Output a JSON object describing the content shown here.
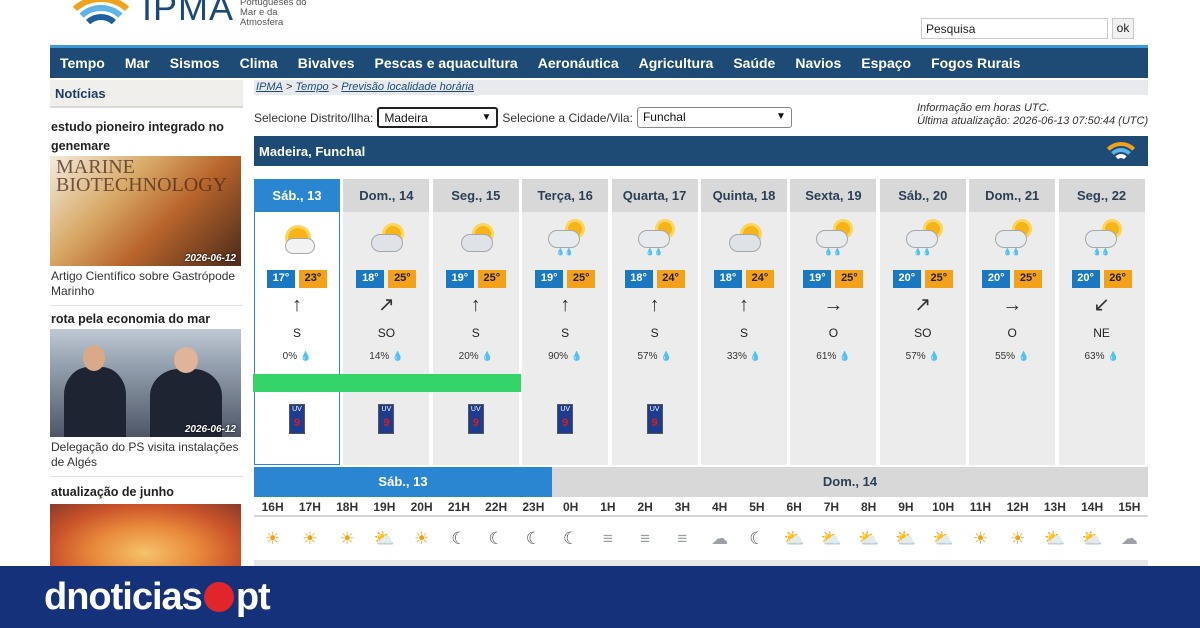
{
  "header": {
    "logo_name": "IPMA",
    "logo_subtitle": "Portuguêses do Mar e da Atmosfera",
    "search_value": "Pesquisa",
    "search_button": "ok"
  },
  "nav": [
    "Tempo",
    "Mar",
    "Sismos",
    "Clima",
    "Bivalves",
    "Pescas e aquacultura",
    "Aeronáutica",
    "Agricultura",
    "Saúde",
    "Navios",
    "Espaço",
    "Fogos Rurais"
  ],
  "sidebar": {
    "heading": "Notícias",
    "news": [
      {
        "title": "estudo pioneiro integrado no genemare",
        "image_text": "MARINE BIOTECHNOLOGY",
        "date": "2026-06-12",
        "caption": "Artigo Científico sobre Gastrópode Marinho"
      },
      {
        "title": "rota pela economia do mar",
        "date": "2026-06-12",
        "caption": "Delegação do PS visita instalações de Algés"
      },
      {
        "title": "atualização de junho"
      }
    ]
  },
  "breadcrumb": {
    "items": [
      "IPMA",
      "Tempo",
      "Previsão localidade horária"
    ],
    "sep": " > "
  },
  "selectors": {
    "district_label": "Selecione Distrito/Ilha:",
    "district_value": "Madeira",
    "city_label": "Selecione a Cidade/Vila:",
    "city_value": "Funchal"
  },
  "info": {
    "line1": "Informação em horas UTC.",
    "line2": "Última atualização: 2026-06-13 07:50:44 (UTC)"
  },
  "location_title": "Madeira, Funchal",
  "days": [
    {
      "label": "Sáb., 13",
      "min": "17°",
      "max": "23°",
      "wind_glyph": "↑",
      "wind": "S",
      "precip": "0%",
      "icon": "sun-cloud",
      "bar": true,
      "uv": "9"
    },
    {
      "label": "Dom., 14",
      "min": "18°",
      "max": "25°",
      "wind_glyph": "↗",
      "wind": "SO",
      "precip": "14%",
      "icon": "sun-cloud-grey",
      "bar": true,
      "uv": "9"
    },
    {
      "label": "Seg., 15",
      "min": "19°",
      "max": "25°",
      "wind_glyph": "↑",
      "wind": "S",
      "precip": "20%",
      "icon": "sun-cloud-grey",
      "bar": true,
      "uv": "9"
    },
    {
      "label": "Terça, 16",
      "min": "19°",
      "max": "25°",
      "wind_glyph": "↑",
      "wind": "S",
      "precip": "90%",
      "icon": "rain",
      "bar": false,
      "uv": "9"
    },
    {
      "label": "Quarta, 17",
      "min": "18°",
      "max": "24°",
      "wind_glyph": "↑",
      "wind": "S",
      "precip": "57%",
      "icon": "rain",
      "bar": false,
      "uv": "9"
    },
    {
      "label": "Quinta, 18",
      "min": "18°",
      "max": "24°",
      "wind_glyph": "↑",
      "wind": "S",
      "precip": "33%",
      "icon": "sun-cloud-grey",
      "bar": false,
      "uv": ""
    },
    {
      "label": "Sexta, 19",
      "min": "19°",
      "max": "25°",
      "wind_glyph": "→",
      "wind": "O",
      "precip": "61%",
      "icon": "rain",
      "bar": false,
      "uv": ""
    },
    {
      "label": "Sáb., 20",
      "min": "20°",
      "max": "25°",
      "wind_glyph": "↗",
      "wind": "SO",
      "precip": "57%",
      "icon": "rain",
      "bar": false,
      "uv": ""
    },
    {
      "label": "Dom., 21",
      "min": "20°",
      "max": "25°",
      "wind_glyph": "→",
      "wind": "O",
      "precip": "55%",
      "icon": "rain",
      "bar": false,
      "uv": ""
    },
    {
      "label": "Seg., 22",
      "min": "20°",
      "max": "26°",
      "wind_glyph": "↙",
      "wind": "NE",
      "precip": "63%",
      "icon": "rain",
      "bar": false,
      "uv": ""
    }
  ],
  "hourly": {
    "day1": "Sáb., 13",
    "day2": "Dom., 14",
    "hours": [
      "16H",
      "17H",
      "18H",
      "19H",
      "20H",
      "21H",
      "22H",
      "23H",
      "0H",
      "1H",
      "2H",
      "3H",
      "4H",
      "5H",
      "6H",
      "7H",
      "8H",
      "9H",
      "10H",
      "11H",
      "12H",
      "13H",
      "14H",
      "15H"
    ],
    "icons": [
      "☀",
      "☀",
      "☀",
      "⛅",
      "☀",
      "☾",
      "☾",
      "☾",
      "☾",
      "≡",
      "≡",
      "≡",
      "☁",
      "☾",
      "⛅",
      "⛅",
      "⛅",
      "⛅",
      "⛅",
      "☀",
      "☀",
      "⛅",
      "⛅",
      "☁"
    ]
  },
  "footer": {
    "brand_left": "dnoticias",
    "brand_right": "pt"
  },
  "colors": {
    "nav": "#1d4b76",
    "accent": "#2a86d0",
    "min_temp": "#1a78c2",
    "max_temp": "#f4a11a",
    "bar": "#35d46a",
    "footer": "#14317a",
    "brand_dot": "#e0252b"
  }
}
